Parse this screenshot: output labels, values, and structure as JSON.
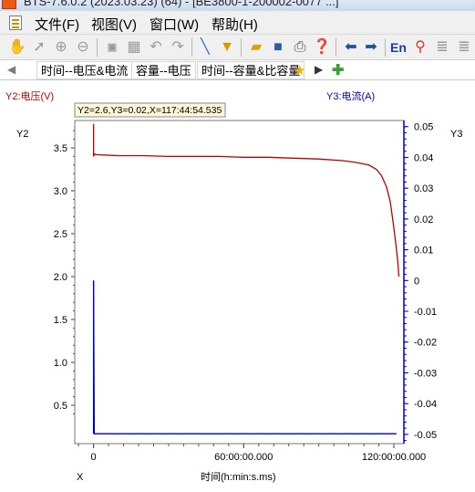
{
  "window": {
    "title": "BTS-7.6.0.2 (2023.03.23) (64) - [BE3800-1-200002-0077 ...]"
  },
  "menu": {
    "file": "文件(F)",
    "view": "视图(V)",
    "window": "窗口(W)",
    "help": "帮助(H)"
  },
  "toolbar": {
    "icons": [
      "hand-icon",
      "pointer-icon",
      "zoom-in-icon",
      "zoom-out-icon",
      "reset-icon",
      "grid-icon",
      "undo-icon",
      "redo-icon",
      "line-icon",
      "filter-icon",
      "open-icon",
      "save-icon",
      "print-icon",
      "help-icon",
      "back-icon",
      "forward-icon",
      "language-icon",
      "marker-icon",
      "align-left-icon",
      "align-right-icon"
    ],
    "language_label": "En"
  },
  "tabs": [
    {
      "label": "时间--电压&电流",
      "active": true
    },
    {
      "label": "容量--电压",
      "active": false
    },
    {
      "label": "时间--容量&比容量",
      "active": false
    }
  ],
  "chart_data": {
    "type": "line",
    "y2_label": "Y2:电压(V)",
    "y3_label": "Y3:电流(A)",
    "y2_axis_name": "Y2",
    "y3_axis_name": "Y3",
    "x_axis_name": "X",
    "xlabel": "时间(h:min:s.ms)",
    "tooltip": "Y2=2.6,Y3=0.02,X=117:44:54.535",
    "x_unit": "hours",
    "xlim": [
      -7.5,
      124
    ],
    "x_ticks": [
      {
        "value": 0,
        "label": "0"
      },
      {
        "value": 60,
        "label": "60:00:00.000"
      },
      {
        "value": 120,
        "label": "120:00:00.000"
      }
    ],
    "y2_lim": [
      2.1,
      3.9
    ],
    "y2_ticks": [
      "3.5",
      "3.0",
      "2.5",
      "2.0",
      "1.5",
      "1.0",
      "0.5"
    ],
    "y2_tick_values": [
      3.5,
      3.0,
      2.5,
      2.0,
      1.5,
      1.0,
      0.5
    ],
    "y3_lim": [
      -0.053,
      0.052
    ],
    "y3_ticks": [
      "0.05",
      "0.04",
      "0.03",
      "0.02",
      "0.01",
      "0",
      "-0.01",
      "-0.02",
      "-0.03",
      "-0.04",
      "-0.05"
    ],
    "y3_tick_values": [
      0.05,
      0.04,
      0.03,
      0.02,
      0.01,
      0,
      -0.01,
      -0.02,
      -0.03,
      -0.04,
      -0.05
    ],
    "grid": true,
    "series": [
      {
        "name": "电压",
        "axis": "y2",
        "color": "#c00000",
        "x": [
          0,
          0,
          0.3,
          1,
          10,
          20,
          30,
          40,
          50,
          60,
          70,
          80,
          90,
          100,
          105,
          110,
          113,
          115,
          117,
          118.5,
          119.5,
          120.5,
          121.5,
          122
        ],
        "y": [
          3.78,
          3.4,
          3.43,
          3.42,
          3.41,
          3.41,
          3.4,
          3.4,
          3.4,
          3.39,
          3.39,
          3.38,
          3.37,
          3.35,
          3.33,
          3.3,
          3.25,
          3.18,
          3.05,
          2.88,
          2.68,
          2.45,
          2.2,
          2.0
        ]
      },
      {
        "name": "电流",
        "axis": "y3",
        "color": "#0000c0",
        "x": [
          0,
          0,
          0.3,
          121
        ],
        "y": [
          0.0,
          0.0,
          -0.0498,
          -0.0498
        ]
      }
    ],
    "colors": {
      "y2_axis": "#c00000",
      "y3_axis": "#0000c0",
      "grid": "#b8b8b8",
      "tooltip_bg": "#fff8d8"
    }
  }
}
